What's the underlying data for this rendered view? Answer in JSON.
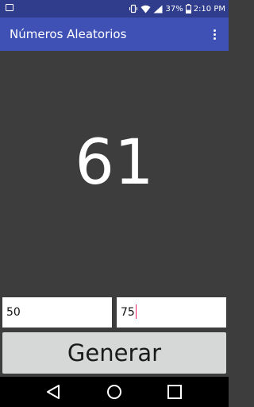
{
  "status_bar": {
    "battery_percent": "37%",
    "time": "2:10 PM",
    "icons": [
      "notification-icon",
      "vibrate-icon",
      "wifi-icon",
      "signal-icon",
      "battery-icon"
    ]
  },
  "app_bar": {
    "title": "Números Aleatorios",
    "menu_icon": "overflow-menu-icon"
  },
  "result": {
    "value": "61"
  },
  "inputs": {
    "min_value": "50",
    "max_value": "75"
  },
  "generate_button": {
    "label": "Generar"
  },
  "nav_bar": {
    "icons": [
      "back-icon",
      "home-icon",
      "recents-icon"
    ]
  },
  "colors": {
    "status_bar": "#2f3d8c",
    "app_bar": "#3f51b5",
    "background": "#3d3d3d",
    "button": "#d6d7d7",
    "caret": "#e91e63"
  }
}
